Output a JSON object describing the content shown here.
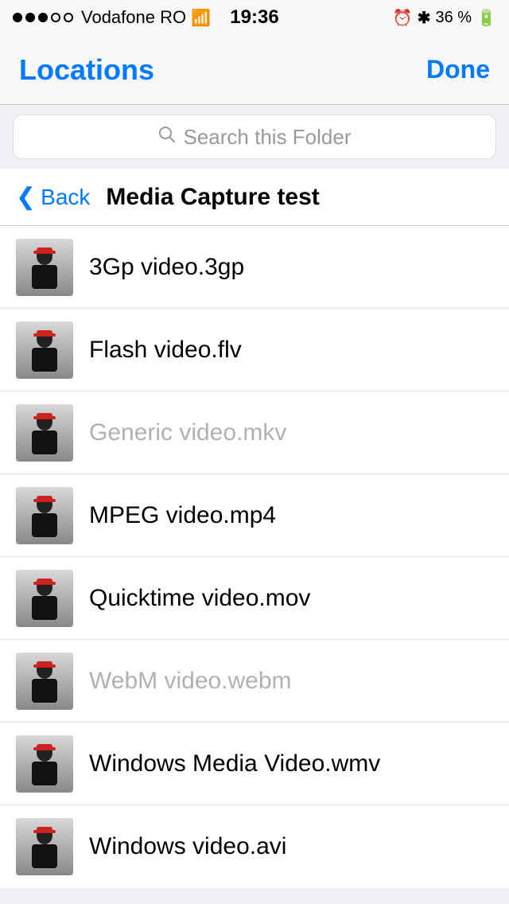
{
  "statusBar": {
    "carrier": "Vodafone RO",
    "time": "19:36",
    "battery": "36 %",
    "signalDots": [
      "filled",
      "filled",
      "filled",
      "empty",
      "empty"
    ]
  },
  "navBar": {
    "title": "Locations",
    "doneLabel": "Done"
  },
  "searchBar": {
    "placeholder": "Search this Folder"
  },
  "subNav": {
    "backLabel": "Back",
    "title": "Media Capture test"
  },
  "files": [
    {
      "name": "3Gp video.3gp",
      "disabled": false
    },
    {
      "name": "Flash video.flv",
      "disabled": false
    },
    {
      "name": "Generic video.mkv",
      "disabled": true
    },
    {
      "name": "MPEG video.mp4",
      "disabled": false
    },
    {
      "name": "Quicktime video.mov",
      "disabled": false
    },
    {
      "name": "WebM video.webm",
      "disabled": true
    },
    {
      "name": "Windows Media Video.wmv",
      "disabled": false
    },
    {
      "name": "Windows video.avi",
      "disabled": false
    }
  ]
}
